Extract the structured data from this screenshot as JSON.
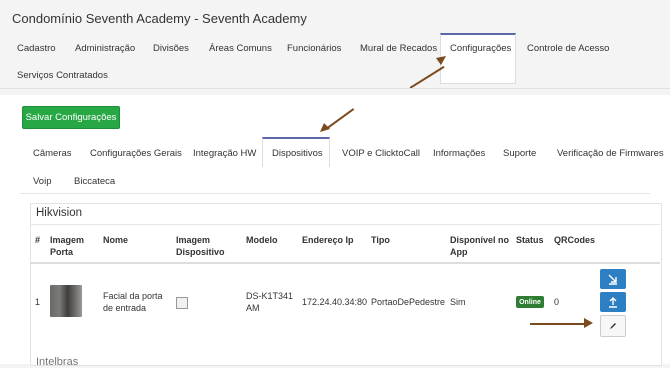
{
  "app": {
    "title": "Condomínio Seventh Academy - Seventh Academy"
  },
  "top_tabs": [
    {
      "label": "Cadastro"
    },
    {
      "label": "Administração"
    },
    {
      "label": "Divisões"
    },
    {
      "label": "Áreas Comuns"
    },
    {
      "label": "Funcionários"
    },
    {
      "label": "Mural de Recados"
    },
    {
      "label": "Configurações"
    },
    {
      "label": "Controle de Acesso"
    },
    {
      "label": "Serviços Contratados"
    }
  ],
  "toolbar": {
    "save_label": "Salvar Configurações"
  },
  "sub_tabs": [
    {
      "label": "Câmeras"
    },
    {
      "label": "Configurações Gerais"
    },
    {
      "label": "Integração HW"
    },
    {
      "label": "Dispositivos"
    },
    {
      "label": "VOIP e ClicktoCall"
    },
    {
      "label": "Informações"
    },
    {
      "label": "Suporte"
    },
    {
      "label": "Verificação de Firmwares"
    },
    {
      "label": "Voip"
    },
    {
      "label": "Biccateca"
    }
  ],
  "device_group": {
    "title": "Hikvision",
    "columns": {
      "num": "#",
      "imagem_porta": "Imagem Porta",
      "nome": "Nome",
      "imagem_dispositivo": "Imagem Dispositivo",
      "modelo": "Modelo",
      "endereco_ip": "Endereço Ip",
      "tipo": "Tipo",
      "disponivel_no_app": "Disponível no App",
      "status": "Status",
      "qrcodes": "QRCodes"
    },
    "rows": [
      {
        "num": "1",
        "nome": "Facial da porta de entrada",
        "modelo": "DS-K1T341AM",
        "endereco_ip": "172.24.40.34:80",
        "tipo": "PortaoDePedestre",
        "disponivel_no_app": "Sim",
        "status": "Online",
        "qrcodes": "0"
      }
    ]
  },
  "next_group": {
    "title": "Intelbras"
  },
  "colors": {
    "accent": "#5a6aa8",
    "save_button": "#28a745",
    "status_online": "#2e7d32",
    "qr_button": "#2d7fc4",
    "arrow": "#7b4a1e"
  },
  "icons": {
    "download": "download-icon",
    "upload": "upload-icon",
    "edit": "pencil-icon"
  }
}
